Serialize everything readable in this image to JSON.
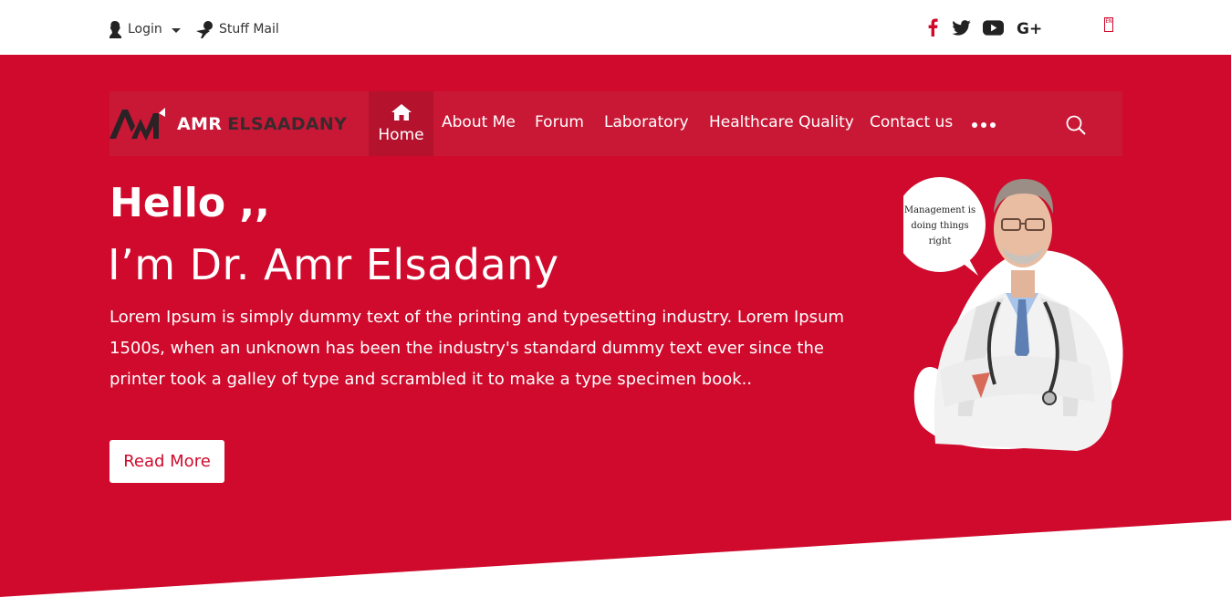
{
  "topbar": {
    "login_label": "Login",
    "mail_label": "Stuff Mail",
    "social_icons": [
      "facebook-icon",
      "twitter-icon",
      "youtube-icon",
      "google-plus-icon"
    ],
    "social_colors": {
      "facebook": "#cf0a2c",
      "default": "#222222"
    }
  },
  "navbar": {
    "brand": {
      "first": "AMR",
      "last": "ELSAADANY"
    },
    "items": [
      {
        "label": "Home",
        "active": true
      },
      {
        "label": "About Me"
      },
      {
        "label": "Forum"
      },
      {
        "label": "Laboratory"
      },
      {
        "label": "Healthcare Quality"
      },
      {
        "label": "Contact us"
      }
    ]
  },
  "hero": {
    "greeting": "Hello ,,",
    "name": "I’m Dr. Amr Elsadany",
    "description": "Lorem Ipsum is simply dummy text of the printing and typesetting industry. Lorem Ipsum 1500s, when an unknown has been the industry's standard dummy text ever since the printer took a galley of type and scrambled it to make a type specimen book..",
    "button_label": "Read More",
    "bubble_text": "Management is doing things right"
  },
  "colors": {
    "brand_red": "#cf0a2c",
    "nav_bg": "#c91836",
    "active_bg": "#b5122e"
  }
}
